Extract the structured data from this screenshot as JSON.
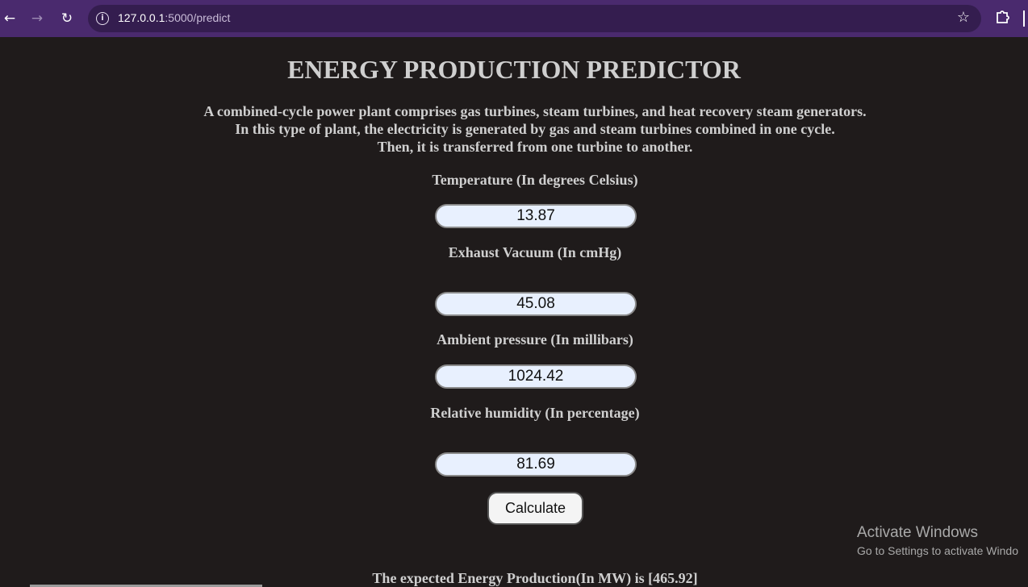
{
  "browser": {
    "url_host": "127.0.0.1",
    "url_path": ":5000/predict",
    "icons": {
      "back": "arrow-left-icon",
      "forward": "arrow-right-icon",
      "reload": "reload-icon",
      "site_info": "info-icon",
      "bookmark": "star-icon",
      "extensions": "puzzle-icon"
    }
  },
  "page": {
    "title": "ENERGY PRODUCTION PREDICTOR",
    "intro_lines": [
      "A combined-cycle power plant comprises gas turbines, steam turbines, and heat recovery steam generators.",
      "In this type of plant, the electricity is generated by gas and steam turbines combined in one cycle.",
      "Then, it is transferred from one turbine to another."
    ],
    "fields": [
      {
        "label": "Temperature (In degrees Celsius)",
        "value": "13.87"
      },
      {
        "label": "Exhaust Vacuum (In cmHg)",
        "value": "45.08"
      },
      {
        "label": "Ambient pressure (In millibars)",
        "value": "1024.42"
      },
      {
        "label": "Relative humidity (In percentage)",
        "value": "81.69"
      }
    ],
    "calculate_label": "Calculate",
    "result_text": "The expected Energy Production(In MW) is [465.92]"
  },
  "watermark": {
    "title": "Activate Windows",
    "subtitle": "Go to Settings to activate Windo"
  },
  "colors": {
    "page_background": "#1f1b1b",
    "browser_toolbar": "#4a2a6e",
    "text": "#cfcfcf",
    "input_background": "#e8f0fe"
  }
}
